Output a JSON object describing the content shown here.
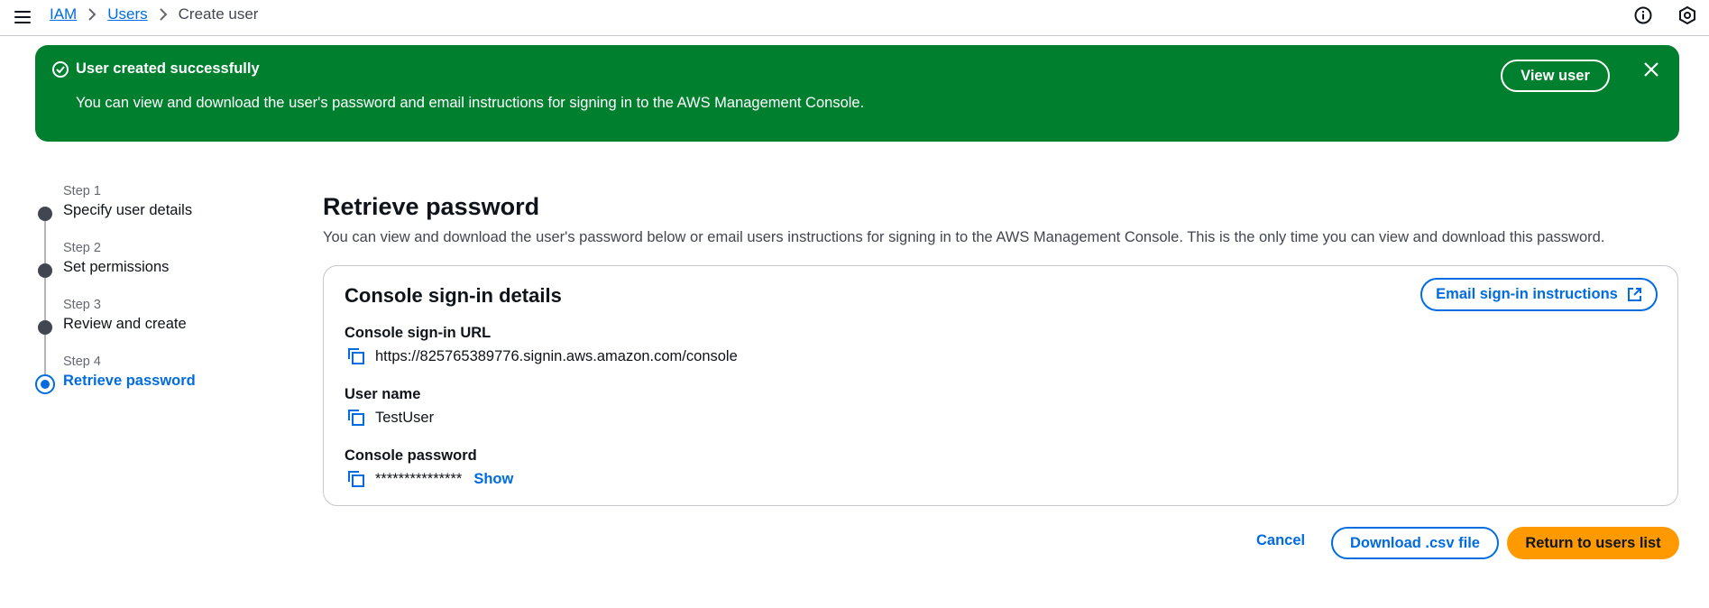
{
  "breadcrumb": {
    "items": [
      "IAM",
      "Users"
    ],
    "current": "Create user"
  },
  "icons": {
    "menu": "hamburger-menu-icon",
    "info": "info-icon",
    "settings": "settings-hexagon-icon",
    "success": "check-circle-icon",
    "close": "close-icon",
    "copy": "copy-icon",
    "external": "external-link-icon",
    "chevron": "chevron-right-icon"
  },
  "flash": {
    "title": "User created successfully",
    "message": "You can view and download the user's password and email instructions for signing in to the AWS Management Console.",
    "action_label": "View user",
    "color": "#00802f"
  },
  "steps": [
    {
      "number": "Step 1",
      "label": "Specify user details",
      "active": false
    },
    {
      "number": "Step 2",
      "label": "Set permissions",
      "active": false
    },
    {
      "number": "Step 3",
      "label": "Review and create",
      "active": false
    },
    {
      "number": "Step 4",
      "label": "Retrieve password",
      "active": true
    }
  ],
  "page": {
    "title": "Retrieve password",
    "description": "You can view and download the user's password below or email users instructions for signing in to the AWS Management Console. This is the only time you can view and download this password."
  },
  "panel": {
    "title": "Console sign-in details",
    "email_button_label": "Email sign-in instructions",
    "fields": {
      "url": {
        "label": "Console sign-in URL",
        "value": "https://825765389776.signin.aws.amazon.com/console"
      },
      "username": {
        "label": "User name",
        "value": "TestUser"
      },
      "password": {
        "label": "Console password",
        "value": "***************",
        "show_label": "Show"
      }
    }
  },
  "actions": {
    "cancel": "Cancel",
    "download": "Download .csv file",
    "return": "Return to users list"
  },
  "colors": {
    "accent": "#006ce0",
    "primary_button": "#ff9900",
    "success": "#00802f"
  }
}
